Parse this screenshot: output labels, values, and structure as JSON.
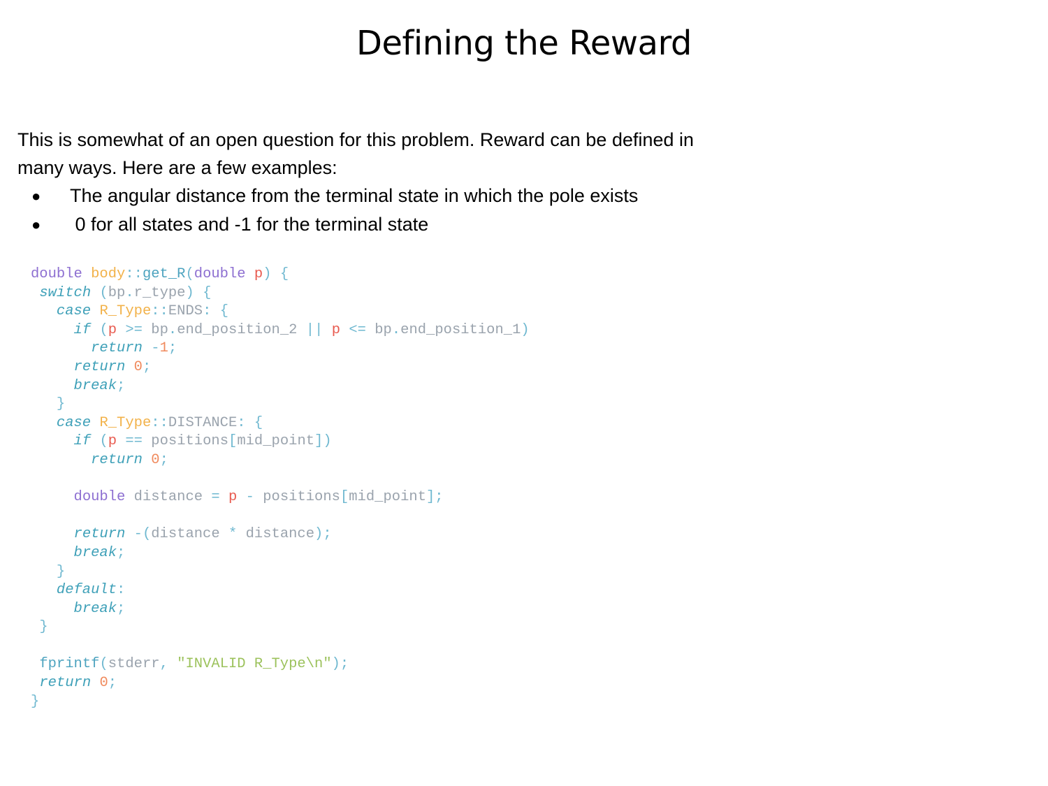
{
  "title": "Defining the Reward",
  "intro": "This is somewhat of an open question for this problem. Reward can be defined in many ways. Here are a few examples:",
  "bullets": [
    "The angular distance from the terminal state in which the pole exists",
    " 0 for all states and -1 for the terminal state"
  ],
  "bullet_glyph": "●",
  "code_lines": [
    "double body::get_R(double p) {",
    " switch (bp.r_type) {",
    "   case R_Type::ENDS: {",
    "     if (p >= bp.end_position_2 || p <= bp.end_position_1)",
    "       return -1;",
    "     return 0;",
    "     break;",
    "   }",
    "   case R_Type::DISTANCE: {",
    "     if (p == positions[mid_point])",
    "       return 0;",
    "",
    "     double distance = p - positions[mid_point];",
    "",
    "     return -(distance * distance);",
    "     break;",
    "   }",
    "   default:",
    "     break;",
    " }",
    "",
    " fprintf(stderr, \"INVALID R_Type\\n\");",
    " return 0;",
    "}"
  ]
}
